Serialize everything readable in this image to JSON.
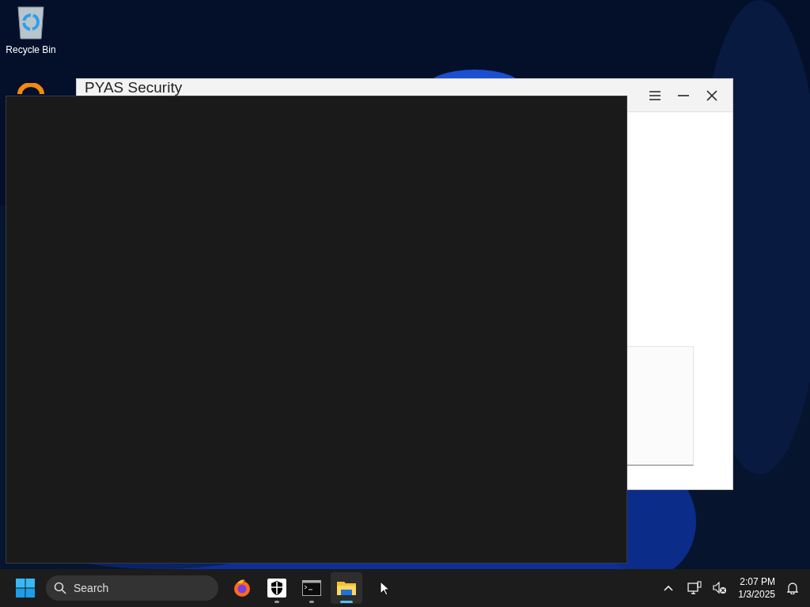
{
  "desktop_icons": [
    {
      "kind": "recycle",
      "label": "Recycle Bin"
    },
    {
      "kind": "orange_ring"
    }
  ],
  "window": {
    "title": "PYAS Security"
  },
  "taskbar": {
    "search": {
      "placeholder": "Search"
    },
    "apps": [
      {
        "kind": "firefox",
        "running": false,
        "selected": false
      },
      {
        "kind": "shield",
        "running": true,
        "selected": false
      },
      {
        "kind": "terminal",
        "running": true,
        "selected": false
      },
      {
        "kind": "explorer",
        "running": true,
        "selected": true
      }
    ],
    "tray": {
      "sound_muted": true
    },
    "clock": {
      "time": "2:07 PM",
      "date": "1/3/2025"
    }
  }
}
